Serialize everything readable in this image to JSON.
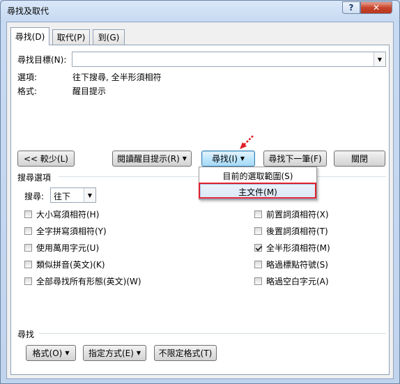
{
  "window": {
    "title": "尋找及取代",
    "help_label": "?",
    "close_label": "✕"
  },
  "tabs": [
    {
      "label": "尋找(D)",
      "active": true
    },
    {
      "label": "取代(P)",
      "active": false
    },
    {
      "label": "到(G)",
      "active": false
    }
  ],
  "find": {
    "label": "尋找目標(N):",
    "value": "",
    "options_label": "選項:",
    "options_value": "往下搜尋, 全半形須相符",
    "format_label": "格式:",
    "format_value": "醒目提示"
  },
  "buttons": {
    "less": "<< 較少(L)",
    "reading_highlight": "閱讀醒目提示(R)",
    "find_in": "尋找(I)",
    "find_next": "尋找下一筆(F)",
    "close": "關閉"
  },
  "dropdown_menu": {
    "items": [
      "目前的選取範圍(S)",
      "主文件(M)"
    ],
    "highlighted_index": 1
  },
  "search_options": {
    "section_label": "搜尋選項",
    "search_label": "搜尋:",
    "search_value": "往下",
    "left_options": [
      {
        "label": "大小寫須相符(H)",
        "checked": false
      },
      {
        "label": "全字拼寫須相符(Y)",
        "checked": false
      },
      {
        "label": "使用萬用字元(U)",
        "checked": false
      },
      {
        "label": "類似拼音(英文)(K)",
        "checked": false
      },
      {
        "label": "全部尋找所有形態(英文)(W)",
        "checked": false
      }
    ],
    "right_options": [
      {
        "label": "前置詞須相符(X)",
        "checked": false
      },
      {
        "label": "後置詞須相符(T)",
        "checked": false
      },
      {
        "label": "全半形須相符(M)",
        "checked": true
      },
      {
        "label": "略過標點符號(S)",
        "checked": false
      },
      {
        "label": "略過空白字元(A)",
        "checked": false
      }
    ]
  },
  "find_section": {
    "label": "尋找",
    "format_button": "格式(O)",
    "special_button": "指定方式(E)",
    "no_format_button": "不限定格式(T)"
  },
  "colors": {
    "accent_red": "#e0202a",
    "focus_blue": "#3c7fb1",
    "titlebar": "#c7daf2"
  }
}
